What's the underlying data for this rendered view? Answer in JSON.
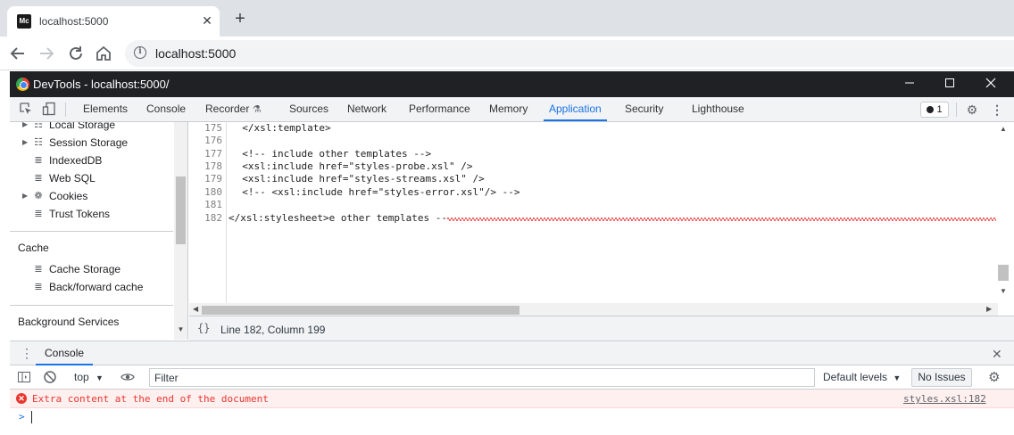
{
  "browser": {
    "tab_title": "localhost:5000",
    "favicon_text": "Mc",
    "url": "localhost:5000"
  },
  "devtools": {
    "window_title": "DevTools - localhost:5000/",
    "tabs": [
      {
        "label": "Elements"
      },
      {
        "label": "Console"
      },
      {
        "label": "Recorder"
      },
      {
        "label": "Sources"
      },
      {
        "label": "Network"
      },
      {
        "label": "Performance"
      },
      {
        "label": "Memory"
      },
      {
        "label": "Application",
        "active": true
      },
      {
        "label": "Security"
      },
      {
        "label": "Lighthouse"
      }
    ],
    "issues_count": "1",
    "accent_color": "#1a73e8"
  },
  "sidebar": {
    "storage_items": [
      {
        "label": "Local Storage",
        "icon": "grid-icon",
        "expandable": true
      },
      {
        "label": "Session Storage",
        "icon": "grid-icon",
        "expandable": true
      },
      {
        "label": "IndexedDB",
        "icon": "database-icon",
        "expandable": false
      },
      {
        "label": "Web SQL",
        "icon": "database-icon",
        "expandable": false
      },
      {
        "label": "Cookies",
        "icon": "cookie-icon",
        "expandable": true
      },
      {
        "label": "Trust Tokens",
        "icon": "database-icon",
        "expandable": false
      }
    ],
    "cache_header": "Cache",
    "cache_items": [
      {
        "label": "Cache Storage",
        "icon": "database-icon"
      },
      {
        "label": "Back/forward cache",
        "icon": "database-icon"
      }
    ],
    "background_header": "Background Services"
  },
  "editor": {
    "lines": [
      {
        "num": "175",
        "text": "  </xsl:template>"
      },
      {
        "num": "176",
        "text": ""
      },
      {
        "num": "177",
        "text": "  <!-- include other templates -->"
      },
      {
        "num": "178",
        "text": "  <xsl:include href=\"styles-probe.xsl\" />"
      },
      {
        "num": "179",
        "text": "  <xsl:include href=\"styles-streams.xsl\" />"
      },
      {
        "num": "180",
        "text": "  <!-- <xsl:include href=\"styles-error.xsl\"/> -->"
      },
      {
        "num": "181",
        "text": ""
      },
      {
        "num": "182",
        "text": "</xsl:stylesheet>e other templates --"
      }
    ],
    "pretty_print": "{}",
    "cursor_position": "Line 182, Column 199"
  },
  "console": {
    "drawer_tab": "Console",
    "context": "top",
    "filter_placeholder": "Filter",
    "levels": "Default levels",
    "issues_button": "No Issues",
    "error": {
      "message": "Extra content at the end of the document",
      "source": "styles.xsl:182",
      "color": "#e8362f"
    },
    "prompt_symbol": ">"
  }
}
